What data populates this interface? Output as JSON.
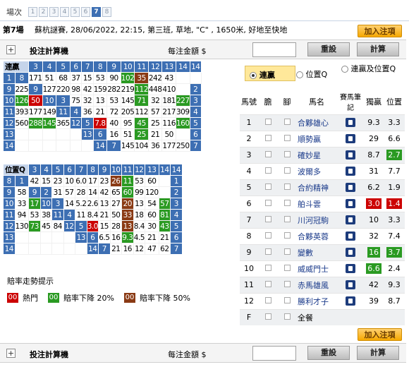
{
  "race_selector": {
    "label": "場次",
    "races": [
      "1",
      "2",
      "3",
      "4",
      "5",
      "6",
      "7",
      "8"
    ],
    "current": "7"
  },
  "race_info": {
    "race_label": "第7場",
    "description": "蘇杭謎賽, 28/06/2022, 22:15, 第三班, 草地, \"C\" , 1650米, 好地至快地",
    "add_button": "加入注項"
  },
  "calculator": {
    "title": "投注計算機",
    "amount_label": "每注金額 $",
    "reset_label": "重設",
    "calc_label": "計算"
  },
  "quinella_grid": {
    "corner": "連贏",
    "col_headers": [
      "2",
      "3",
      "4",
      "5",
      "6",
      "7",
      "8",
      "9",
      "10",
      "11",
      "12",
      "13",
      "14"
    ],
    "rows": [
      {
        "label": "1",
        "side": "",
        "cells": [
          [
            "8",
            "h"
          ],
          [
            "171",
            "w"
          ],
          [
            "51",
            "w"
          ],
          [
            "68",
            "w"
          ],
          [
            "37",
            "w"
          ],
          [
            "15",
            "w"
          ],
          [
            "53",
            "w"
          ],
          [
            "90",
            "w"
          ],
          [
            "102",
            "g"
          ],
          [
            "35",
            "b"
          ],
          [
            "242",
            "w"
          ],
          [
            "43",
            "w"
          ],
          [
            "",
            "w"
          ]
        ]
      },
      {
        "label": "9",
        "side": "2",
        "cells": [
          [
            "225",
            "w"
          ],
          [
            "9",
            "h"
          ],
          [
            "127",
            "w"
          ],
          [
            "220",
            "w"
          ],
          [
            "98",
            "w"
          ],
          [
            "42",
            "w"
          ],
          [
            "159",
            "w"
          ],
          [
            "282",
            "w"
          ],
          [
            "219",
            "w"
          ],
          [
            "112",
            "g"
          ],
          [
            "448",
            "w"
          ],
          [
            "410",
            "w"
          ],
          [
            "",
            "w"
          ]
        ]
      },
      {
        "label": "10",
        "side": "3",
        "cells": [
          [
            "126",
            "g"
          ],
          [
            "50",
            "r"
          ],
          [
            "10",
            "h"
          ],
          [
            "3",
            "h"
          ],
          [
            "75",
            "w"
          ],
          [
            "32",
            "w"
          ],
          [
            "13",
            "w"
          ],
          [
            "53",
            "w"
          ],
          [
            "145",
            "w"
          ],
          [
            "71",
            "g"
          ],
          [
            "32",
            "w"
          ],
          [
            "181",
            "w"
          ],
          [
            "227",
            "g"
          ]
        ]
      },
      {
        "label": "11",
        "side": "4",
        "cells": [
          [
            "393",
            "w"
          ],
          [
            "177",
            "w"
          ],
          [
            "149",
            "w"
          ],
          [
            "11",
            "h"
          ],
          [
            "4",
            "h"
          ],
          [
            "36",
            "w"
          ],
          [
            "21",
            "w"
          ],
          [
            "72",
            "w"
          ],
          [
            "205",
            "w"
          ],
          [
            "112",
            "w"
          ],
          [
            "57",
            "w"
          ],
          [
            "217",
            "w"
          ],
          [
            "309",
            "w"
          ]
        ]
      },
      {
        "label": "12",
        "side": "5",
        "cells": [
          [
            "560",
            "w"
          ],
          [
            "288",
            "g"
          ],
          [
            "145",
            "g"
          ],
          [
            "365",
            "w"
          ],
          [
            "12",
            "h"
          ],
          [
            "5",
            "h"
          ],
          [
            "7.8",
            "r"
          ],
          [
            "40",
            "w"
          ],
          [
            "95",
            "w"
          ],
          [
            "45",
            "g"
          ],
          [
            "25",
            "w"
          ],
          [
            "116",
            "w"
          ],
          [
            "160",
            "g"
          ]
        ]
      },
      {
        "label": "13",
        "side": "6",
        "cells": [
          [
            "",
            "w"
          ],
          [
            "",
            "w"
          ],
          [
            "",
            "w"
          ],
          [
            "",
            "w"
          ],
          [
            "",
            "w"
          ],
          [
            "13",
            "h"
          ],
          [
            "6",
            "h"
          ],
          [
            "16",
            "w"
          ],
          [
            "51",
            "w"
          ],
          [
            "25",
            "g"
          ],
          [
            "21",
            "w"
          ],
          [
            "50",
            "w"
          ],
          [
            "",
            "w"
          ]
        ]
      },
      {
        "label": "14",
        "side": "7",
        "cells": [
          [
            "",
            "w"
          ],
          [
            "",
            "w"
          ],
          [
            "",
            "w"
          ],
          [
            "",
            "w"
          ],
          [
            "",
            "w"
          ],
          [
            "",
            "w"
          ],
          [
            "14",
            "h"
          ],
          [
            "7",
            "h"
          ],
          [
            "145",
            "w"
          ],
          [
            "104",
            "w"
          ],
          [
            "36",
            "w"
          ],
          [
            "177",
            "w"
          ],
          [
            "250",
            "w"
          ]
        ]
      }
    ]
  },
  "place_grid": {
    "corner": "位置Q",
    "col_headers": [
      "2",
      "3",
      "4",
      "5",
      "6",
      "7",
      "8",
      "9",
      "10",
      "11",
      "12",
      "13",
      "14"
    ],
    "rows": [
      {
        "label": "8",
        "side": "1",
        "cells": [
          [
            "1",
            "h"
          ],
          [
            "42",
            "w"
          ],
          [
            "15",
            "w"
          ],
          [
            "23",
            "w"
          ],
          [
            "10",
            "w"
          ],
          [
            "6.0",
            "w"
          ],
          [
            "17",
            "w"
          ],
          [
            "23",
            "w"
          ],
          [
            "26",
            "b"
          ],
          [
            "11",
            "g"
          ],
          [
            "53",
            "w"
          ],
          [
            "60",
            "w"
          ],
          [
            "",
            "w"
          ]
        ]
      },
      {
        "label": "9",
        "side": "2",
        "cells": [
          [
            "58",
            "w"
          ],
          [
            "9",
            "h"
          ],
          [
            "2",
            "h"
          ],
          [
            "31",
            "w"
          ],
          [
            "57",
            "w"
          ],
          [
            "28",
            "w"
          ],
          [
            "14",
            "w"
          ],
          [
            "42",
            "w"
          ],
          [
            "65",
            "w"
          ],
          [
            "60",
            "g"
          ],
          [
            "99",
            "w"
          ],
          [
            "120",
            "w"
          ],
          [
            "",
            "w"
          ]
        ]
      },
      {
        "label": "10",
        "side": "3",
        "cells": [
          [
            "33",
            "w"
          ],
          [
            "17",
            "g"
          ],
          [
            "10",
            "h"
          ],
          [
            "3",
            "h"
          ],
          [
            "14",
            "w"
          ],
          [
            "5.2",
            "w"
          ],
          [
            "2.6",
            "w"
          ],
          [
            "13",
            "w"
          ],
          [
            "27",
            "w"
          ],
          [
            "20",
            "b"
          ],
          [
            "13",
            "w"
          ],
          [
            "54",
            "w"
          ],
          [
            "57",
            "g"
          ]
        ]
      },
      {
        "label": "11",
        "side": "4",
        "cells": [
          [
            "94",
            "w"
          ],
          [
            "53",
            "w"
          ],
          [
            "38",
            "w"
          ],
          [
            "11",
            "h"
          ],
          [
            "4",
            "h"
          ],
          [
            "11",
            "w"
          ],
          [
            "8.4",
            "w"
          ],
          [
            "21",
            "w"
          ],
          [
            "50",
            "w"
          ],
          [
            "33",
            "b"
          ],
          [
            "18",
            "w"
          ],
          [
            "60",
            "w"
          ],
          [
            "81",
            "g"
          ]
        ]
      },
      {
        "label": "12",
        "side": "5",
        "cells": [
          [
            "130",
            "w"
          ],
          [
            "73",
            "g"
          ],
          [
            "45",
            "w"
          ],
          [
            "84",
            "w"
          ],
          [
            "12",
            "h"
          ],
          [
            "5",
            "h"
          ],
          [
            "3.0",
            "r"
          ],
          [
            "15",
            "w"
          ],
          [
            "28",
            "w"
          ],
          [
            "13",
            "b"
          ],
          [
            "8.4",
            "w"
          ],
          [
            "30",
            "w"
          ],
          [
            "43",
            "g"
          ]
        ]
      },
      {
        "label": "13",
        "side": "6",
        "cells": [
          [
            "",
            "w"
          ],
          [
            "",
            "w"
          ],
          [
            "",
            "w"
          ],
          [
            "",
            "w"
          ],
          [
            "",
            "w"
          ],
          [
            "13",
            "h"
          ],
          [
            "6",
            "h"
          ],
          [
            "6.5",
            "w"
          ],
          [
            "16",
            "w"
          ],
          [
            "9.3",
            "g"
          ],
          [
            "4.5",
            "w"
          ],
          [
            "21",
            "w"
          ],
          [
            "21",
            "w"
          ]
        ]
      },
      {
        "label": "14",
        "side": "7",
        "cells": [
          [
            "",
            "w"
          ],
          [
            "",
            "w"
          ],
          [
            "",
            "w"
          ],
          [
            "",
            "w"
          ],
          [
            "",
            "w"
          ],
          [
            "",
            "w"
          ],
          [
            "14",
            "h"
          ],
          [
            "7",
            "h"
          ],
          [
            "21",
            "w"
          ],
          [
            "16",
            "w"
          ],
          [
            "12",
            "w"
          ],
          [
            "47",
            "w"
          ],
          [
            "62",
            "w"
          ]
        ]
      }
    ]
  },
  "legend": {
    "title": "賠率走勢提示",
    "items": [
      {
        "code": "00",
        "label": "熱門",
        "color": "#cc0000"
      },
      {
        "code": "00",
        "label": "賠率下降 20%",
        "color": "#2a9a22"
      },
      {
        "code": "00",
        "label": "賠率下降 50%",
        "color": "#8a3a14"
      }
    ]
  },
  "pool_options": {
    "quinella": "連贏",
    "place_q": "位置Q",
    "both": "連贏及位置Q"
  },
  "runners_table": {
    "headers": [
      "馬號",
      "膽",
      "腳",
      "馬名",
      "賽馬筆記",
      "獨贏",
      "位置"
    ],
    "rows": [
      {
        "no": "1",
        "name": "合夥雄心",
        "win": "9.3",
        "place": "3.3",
        "win_flag": "",
        "place_flag": ""
      },
      {
        "no": "2",
        "name": "順勢贏",
        "win": "29",
        "place": "6.6",
        "win_flag": "",
        "place_flag": ""
      },
      {
        "no": "3",
        "name": "確妙星",
        "win": "8.7",
        "place": "2.7",
        "win_flag": "",
        "place_flag": "g"
      },
      {
        "no": "4",
        "name": "波爾多",
        "win": "31",
        "place": "7.7",
        "win_flag": "",
        "place_flag": ""
      },
      {
        "no": "5",
        "name": "合約精神",
        "win": "6.2",
        "place": "1.9",
        "win_flag": "",
        "place_flag": ""
      },
      {
        "no": "6",
        "name": "舶斗雲",
        "win": "3.0",
        "place": "1.4",
        "win_flag": "r",
        "place_flag": "r"
      },
      {
        "no": "7",
        "name": "川河冠駒",
        "win": "10",
        "place": "3.3",
        "win_flag": "",
        "place_flag": ""
      },
      {
        "no": "8",
        "name": "合夥英蓉",
        "win": "32",
        "place": "7.4",
        "win_flag": "",
        "place_flag": ""
      },
      {
        "no": "9",
        "name": "變數",
        "win": "16",
        "place": "3.7",
        "win_flag": "g",
        "place_flag": "g"
      },
      {
        "no": "10",
        "name": "威威門士",
        "win": "6.6",
        "place": "2.4",
        "win_flag": "g",
        "place_flag": ""
      },
      {
        "no": "11",
        "name": "赤馬雄風",
        "win": "42",
        "place": "9.3",
        "win_flag": "",
        "place_flag": ""
      },
      {
        "no": "12",
        "name": "勝利才子",
        "win": "39",
        "place": "8.7",
        "win_flag": "",
        "place_flag": ""
      }
    ],
    "field_row": {
      "no": "F",
      "name": "全餐"
    }
  }
}
